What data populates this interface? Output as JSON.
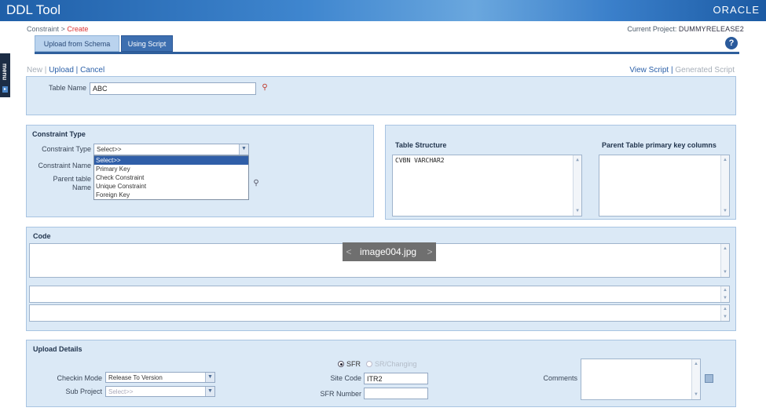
{
  "app": {
    "title": "DDL Tool",
    "brand": "ORACLE"
  },
  "breadcrumb": {
    "parent": "Constraint",
    "separator": ">",
    "current": "Create"
  },
  "project": {
    "label": "Current Project:",
    "value": "DUMMYRELEASE2"
  },
  "tabs": [
    {
      "label": "Upload from Schema"
    },
    {
      "label": "Using Script"
    }
  ],
  "help": {
    "glyph": "?"
  },
  "menu": {
    "label": "menu"
  },
  "actions": {
    "new": "New",
    "upload": "Upload",
    "cancel": "Cancel",
    "sep": "|"
  },
  "view": {
    "view_script": "View Script",
    "sep": "|",
    "generated_script": "Generated Script"
  },
  "table_name": {
    "label": "Table Name",
    "value": "ABC"
  },
  "constraint": {
    "title": "Constraint Type",
    "type_label": "Constraint Type",
    "type_value": "Select>>",
    "name_label": "Constraint Name",
    "parent_label_1": "Parent table",
    "parent_label_2": "Name",
    "options": [
      "Select>>",
      "Primary Key",
      "Check Constraint",
      "Unique Constraint",
      "Foreign Key"
    ]
  },
  "table_structure": {
    "title": "Table Structure",
    "content": "CVBN    VARCHAR2"
  },
  "parent_pk": {
    "title": "Parent Table primary key columns"
  },
  "code": {
    "title": "Code"
  },
  "image_label": {
    "text": "image004.jpg",
    "prev": "<",
    "next": ">"
  },
  "upload_details": {
    "title": "Upload Details",
    "checkin_label": "Checkin Mode",
    "checkin_value": "Release To Version",
    "subproject_label": "Sub Project",
    "subproject_value": "Select>>",
    "radio_sfr": "SFR",
    "radio_sr": "SR/Changing",
    "site_code_label": "Site Code",
    "site_code_value": "ITR2",
    "sfr_number_label": "SFR Number",
    "sfr_number_value": "",
    "comments_label": "Comments"
  }
}
